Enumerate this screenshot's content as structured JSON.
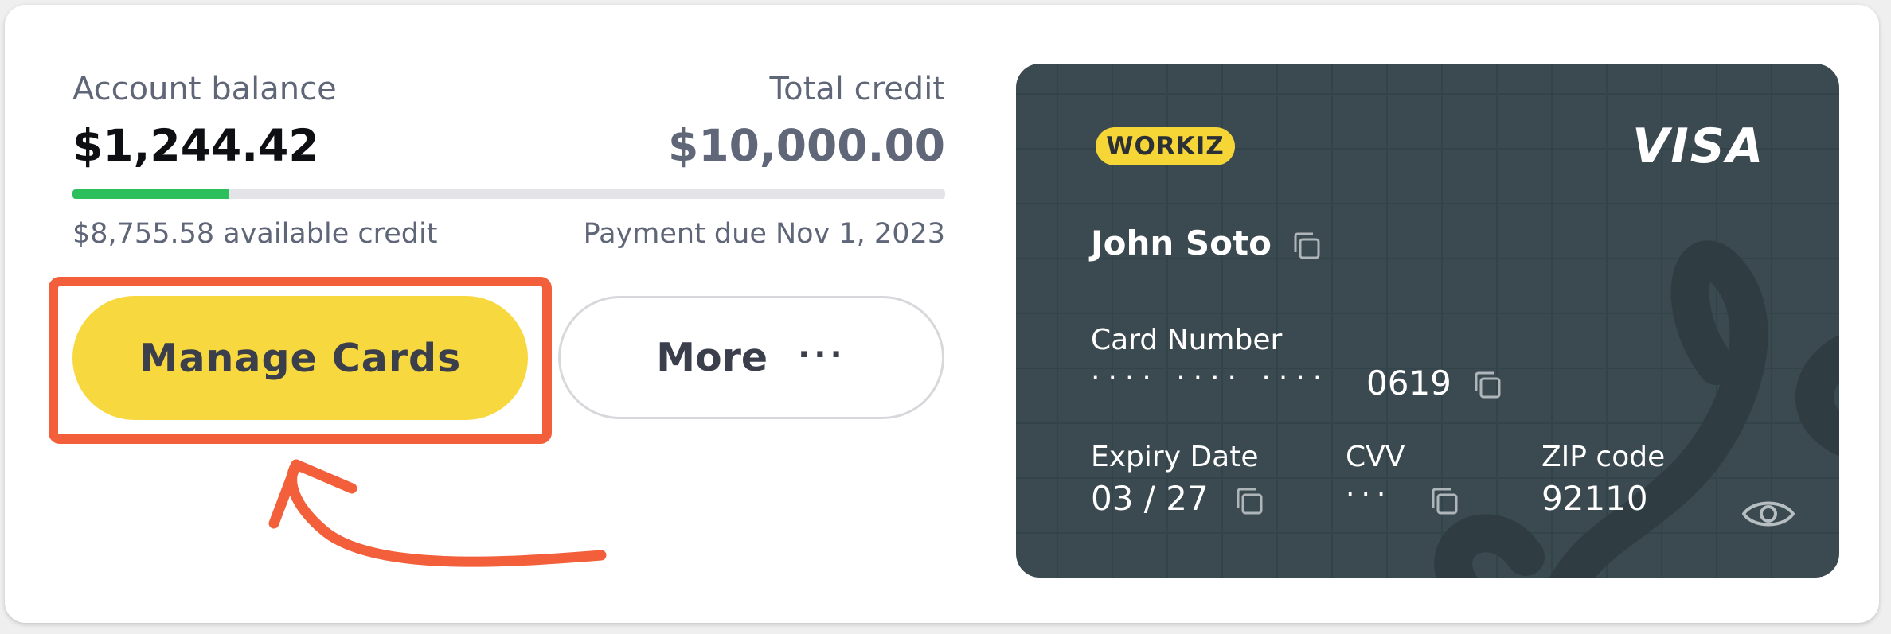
{
  "account": {
    "balance_label": "Account balance",
    "balance_value": "$1,244.42",
    "credit_label": "Total credit",
    "credit_value": "$10,000.00",
    "usage_fraction": 0.18,
    "available_text": "$8,755.58 available credit",
    "payment_due_text": "Payment due Nov 1, 2023"
  },
  "actions": {
    "manage_cards_label": "Manage Cards",
    "more_label": "More",
    "more_dots": "···"
  },
  "card": {
    "brand_logo": "WORKIZ",
    "network": "VISA",
    "holder_name": "John Soto",
    "number_label": "Card Number",
    "number_masked": "····  ····  ····",
    "number_last4": "0619",
    "expiry_label": "Expiry Date",
    "expiry_value": "03 / 27",
    "cvv_label": "CVV",
    "cvv_value": "···",
    "zip_label": "ZIP code",
    "zip_value": "92110"
  },
  "colors": {
    "accent_yellow": "#f8d83f",
    "progress_green": "#2dbf5b",
    "annotation_orange": "#f25f3a",
    "card_background": "#3b4a50"
  },
  "icons": [
    "copy-icon",
    "eye-icon",
    "arrow-annotation"
  ]
}
